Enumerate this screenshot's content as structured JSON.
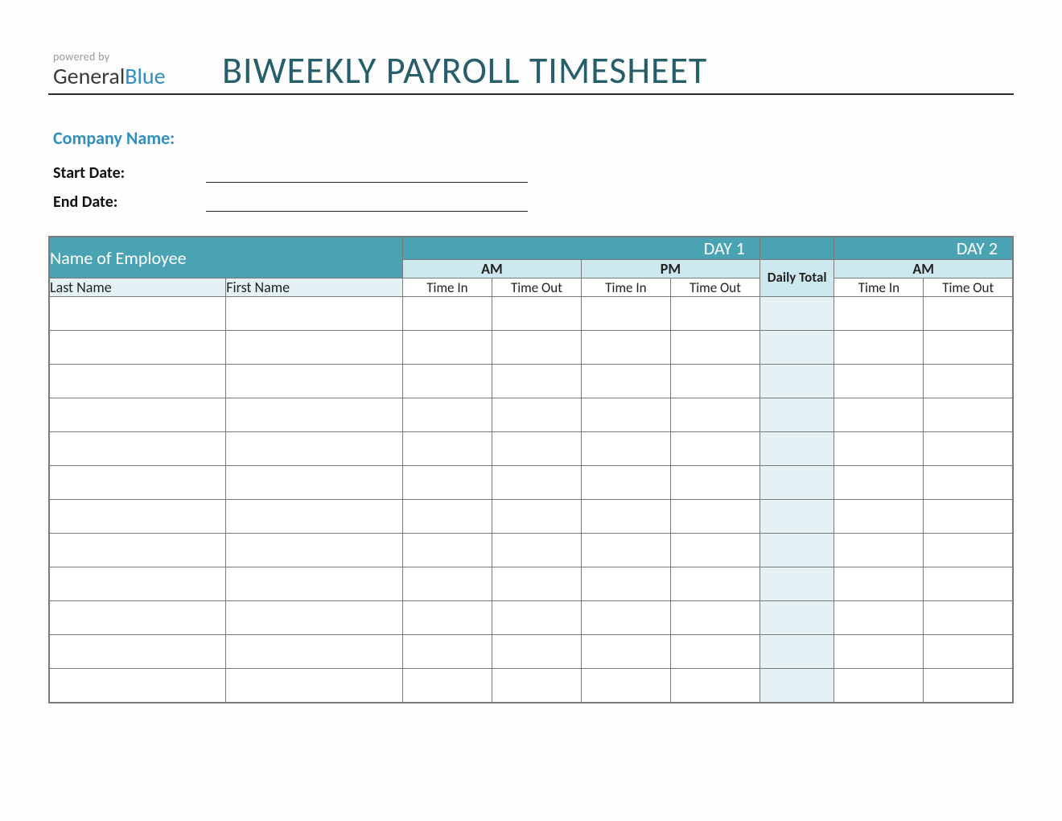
{
  "header": {
    "powered_by": "powered by",
    "logo_general": "General",
    "logo_blue": "Blue",
    "title": "BIWEEKLY PAYROLL TIMESHEET"
  },
  "meta": {
    "company_label": "Company Name:",
    "start_label": "Start Date:",
    "end_label": "End Date:",
    "start_value": "",
    "end_value": ""
  },
  "table": {
    "name_of_employee": "Name of Employee",
    "day1": "DAY 1",
    "day2": "DAY 2",
    "am": "AM",
    "pm": "PM",
    "daily_total": "Daily Total",
    "last_name": "Last Name",
    "first_name": "First Name",
    "time_in": "Time In",
    "time_out": "Time Out"
  },
  "rows": 12
}
